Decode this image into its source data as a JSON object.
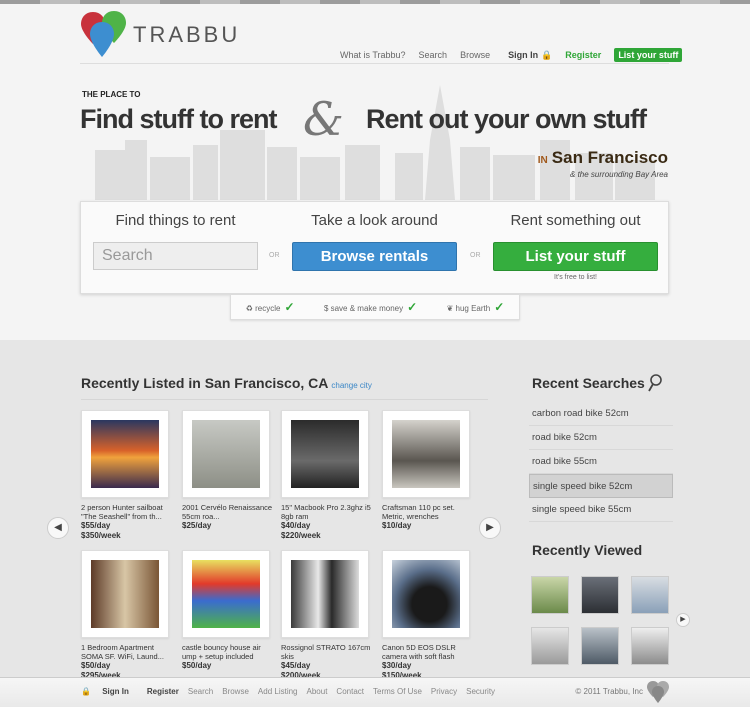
{
  "brand": {
    "name": "TRABBU"
  },
  "nav": {
    "items": [
      "What is Trabbu?",
      "Search",
      "Browse"
    ],
    "sign_in": "Sign In",
    "register": "Register",
    "list_stuff": "List your stuff"
  },
  "hero": {
    "kicker": "THE PLACE TO",
    "headline_left": "Find stuff to rent",
    "ampersand": "&",
    "headline_right": "Rent out your own stuff",
    "in": "IN",
    "city": "San Francisco",
    "subcity": "& the surrounding Bay Area"
  },
  "actions": {
    "find_title": "Find things to rent",
    "search_placeholder": "Search",
    "or": "OR",
    "look_title": "Take a look around",
    "browse_btn": "Browse rentals",
    "rent_title": "Rent something out",
    "list_btn": "List your stuff",
    "free_note": "It's free to list!"
  },
  "perks": [
    "recycle",
    "save & make money",
    "hug Earth"
  ],
  "recent_listed": {
    "title": "Recently Listed in San Francisco, CA",
    "change_city": "change city",
    "items": [
      {
        "title": "2 person Hunter sailboat \"The Seashell\" from th...",
        "price1": "$55/day",
        "price2": "$350/week"
      },
      {
        "title": "2001 Cervélo Renaissance 55cm roa...",
        "price1": "$25/day",
        "price2": ""
      },
      {
        "title": "15\" Macbook Pro 2.3ghz i5 8gb ram",
        "price1": "$40/day",
        "price2": "$220/week"
      },
      {
        "title": "Craftsman 110 pc set. Metric, wrenches",
        "price1": "$10/day",
        "price2": ""
      },
      {
        "title": "1 Bedroom Apartment SOMA SF. WiFi, Laund...",
        "price1": "$50/day",
        "price2": "$295/week"
      },
      {
        "title": "castle bouncy house air ump + setup included",
        "price1": "$50/day",
        "price2": ""
      },
      {
        "title": "Rossignol STRATO 167cm skis",
        "price1": "$45/day",
        "price2": "$200/week"
      },
      {
        "title": "Canon 5D EOS DSLR camera with soft flash",
        "price1": "$30/day",
        "price2": "$150/week"
      }
    ]
  },
  "recent_searches": {
    "title": "Recent Searches",
    "items": [
      "carbon road bike 52cm",
      "road bike 52cm",
      "road bike 55cm",
      "single speed bike 52cm",
      "single speed bike 55cm"
    ],
    "active_index": 3
  },
  "recently_viewed": {
    "title": "Recently Viewed"
  },
  "footer": {
    "sign_in": "Sign In",
    "register": "Register",
    "links": [
      "Search",
      "Browse",
      "Add Listing",
      "About",
      "Contact",
      "Terms Of Use",
      "Privacy",
      "Security"
    ],
    "copyright": "© 2011 Trabbu, Inc"
  },
  "colors": {
    "green": "#35ae3e",
    "blue": "#3d8ed0",
    "logo_red": "#c8323c",
    "logo_blue": "#3d8ed0",
    "logo_green": "#4fb348"
  }
}
